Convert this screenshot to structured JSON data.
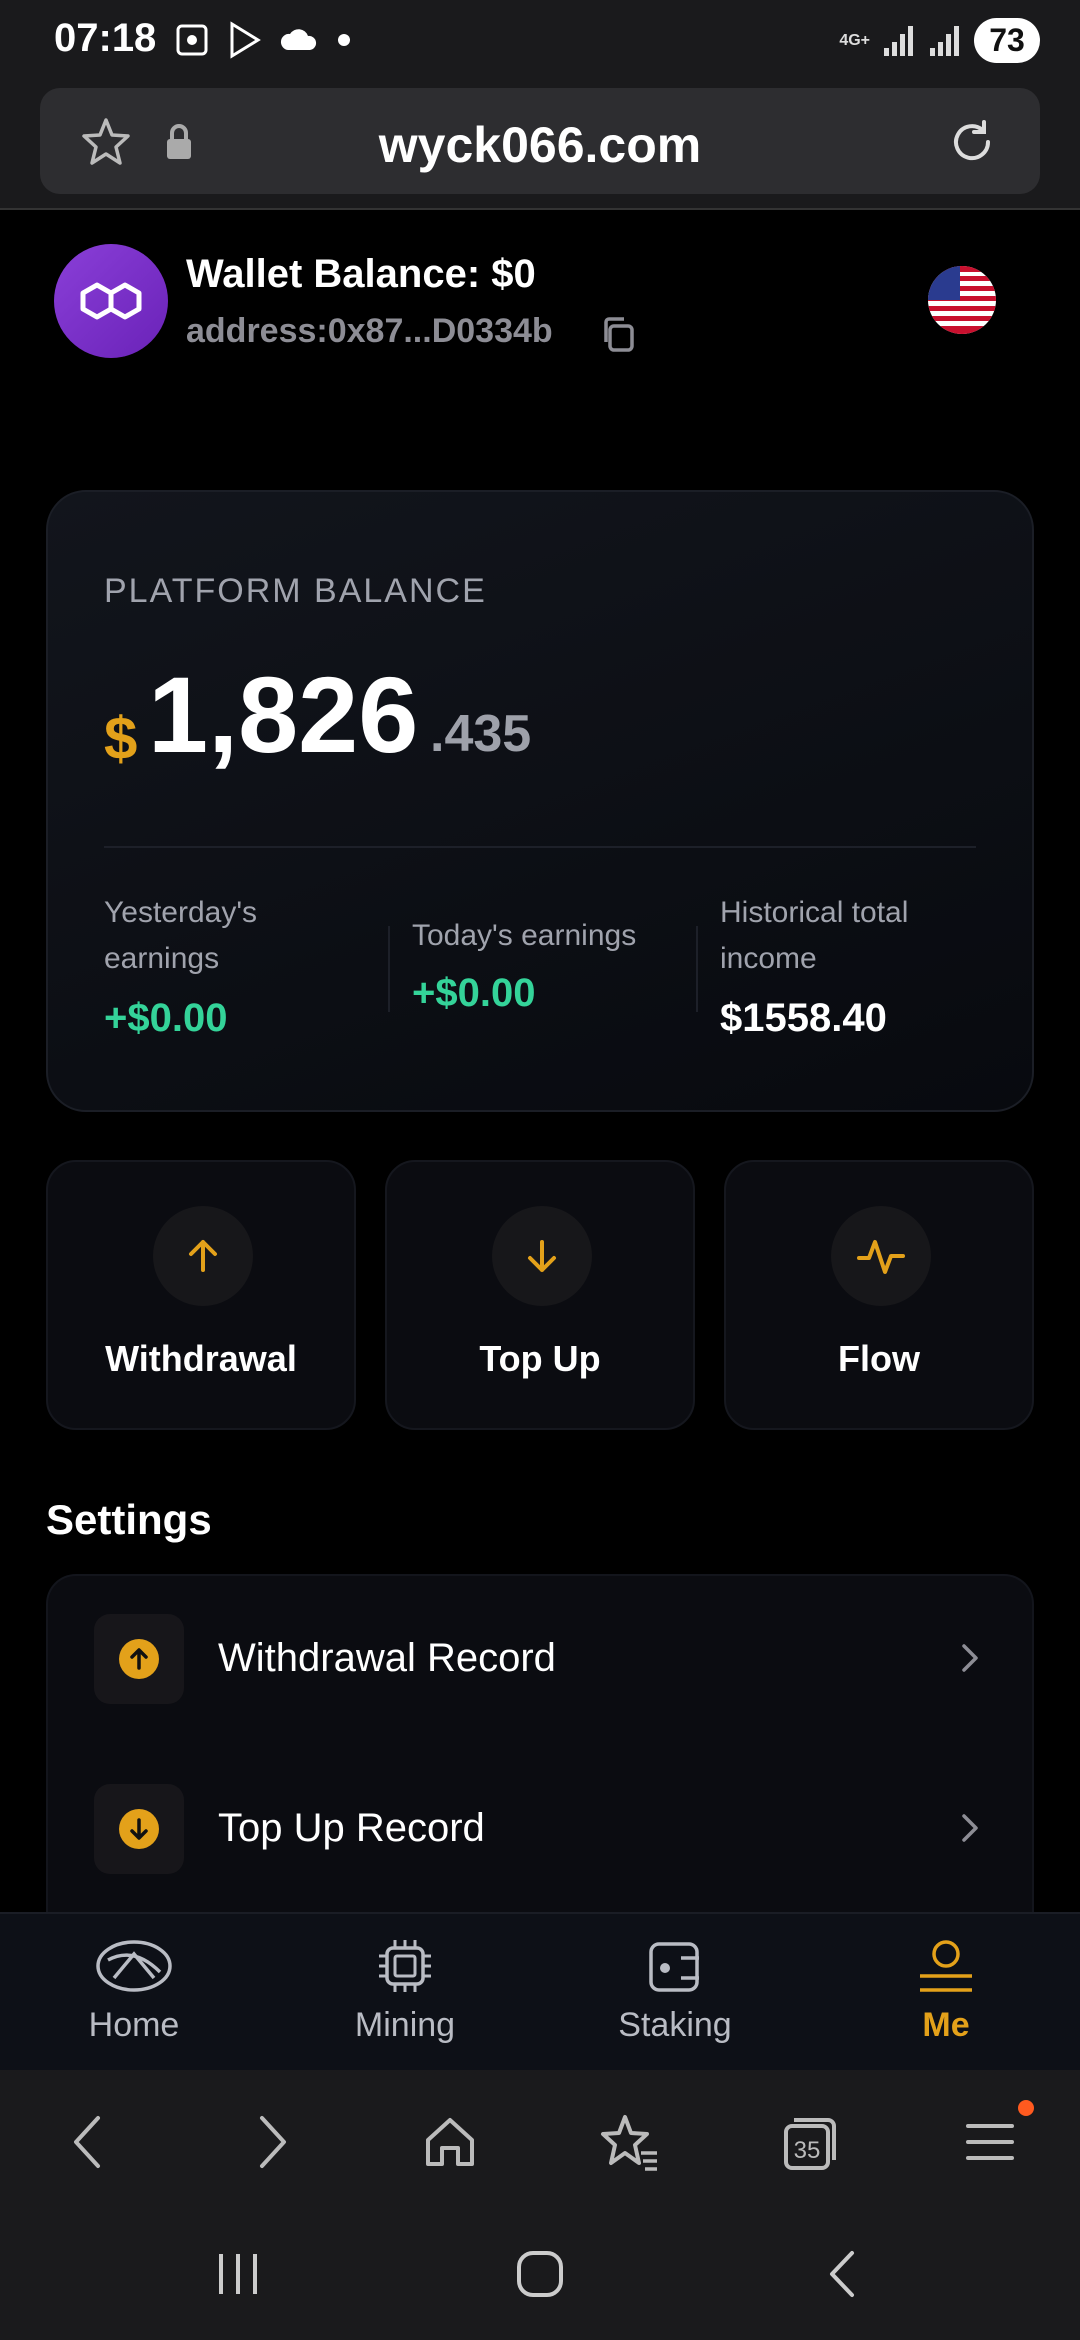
{
  "status_bar": {
    "time": "07:18",
    "network": "4G+",
    "battery": "73",
    "icons": [
      "screenshot-icon",
      "play-store-icon",
      "cloud-icon",
      "dot-icon",
      "signal-icon",
      "signal-icon"
    ]
  },
  "browser": {
    "url": "wyck066.com",
    "icons": [
      "star-icon",
      "lock-icon",
      "reload-icon"
    ]
  },
  "header": {
    "wallet_balance": "Wallet Balance: $0",
    "address": "address:0x87...D0334b",
    "avatar_icon": "polygon-logo-icon",
    "flag_icon": "us-flag-icon"
  },
  "platform": {
    "label": "PLATFORM BALANCE",
    "currency": "$",
    "amount_main": "1,826",
    "amount_decimal": ".435",
    "stats": [
      {
        "label": "Yesterday's earnings",
        "value": "+$0.00"
      },
      {
        "label": "Today's earnings",
        "value": "+$0.00"
      },
      {
        "label": "Historical total income",
        "value": "$1558.40"
      }
    ]
  },
  "actions": [
    {
      "label": "Withdrawal",
      "icon": "arrow-up-icon"
    },
    {
      "label": "Top Up",
      "icon": "arrow-down-icon"
    },
    {
      "label": "Flow",
      "icon": "activity-icon"
    }
  ],
  "settings": {
    "title": "Settings",
    "items": [
      {
        "label": "Withdrawal Record",
        "icon": "upload-circle-icon"
      },
      {
        "label": "Top Up Record",
        "icon": "download-circle-icon"
      }
    ]
  },
  "app_nav": {
    "items": [
      {
        "label": "Home",
        "icon": "home-logo-icon"
      },
      {
        "label": "Mining",
        "icon": "chip-icon"
      },
      {
        "label": "Staking",
        "icon": "wallet-icon"
      },
      {
        "label": "Me",
        "icon": "user-icon",
        "active": true
      }
    ]
  },
  "browser_toolbar": {
    "tabs_count": "35",
    "icons": [
      "back-icon",
      "forward-icon",
      "home-icon",
      "bookmarks-icon",
      "tabs-icon",
      "menu-icon"
    ]
  },
  "colors": {
    "accent": "#e3a11a",
    "positive": "#34d399",
    "background": "#000000"
  }
}
